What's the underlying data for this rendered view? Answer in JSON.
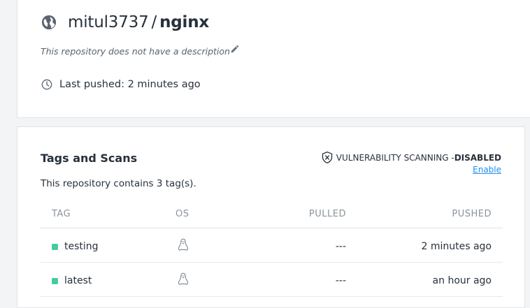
{
  "repo": {
    "owner": "mitul3737",
    "slash": "/",
    "name": "nginx",
    "description": "This repository does not have a description",
    "last_pushed": "Last pushed: 2 minutes ago"
  },
  "tags_section": {
    "title": "Tags and Scans",
    "vuln_label": "VULNERABILITY SCANNING - ",
    "vuln_status": "DISABLED",
    "enable_link": "Enable",
    "count_text": "This repository contains 3 tag(s).",
    "columns": {
      "tag": "TAG",
      "os": "OS",
      "pulled": "PULLED",
      "pushed": "PUSHED"
    },
    "rows": [
      {
        "tag": "testing",
        "os_icon": "linux-icon",
        "pulled": "---",
        "pushed": "2 minutes ago"
      },
      {
        "tag": "latest",
        "os_icon": "linux-icon",
        "pulled": "---",
        "pushed": "an hour ago"
      }
    ]
  },
  "colors": {
    "accent_link": "#1c90ed",
    "tag_dot": "#47c9a2"
  }
}
